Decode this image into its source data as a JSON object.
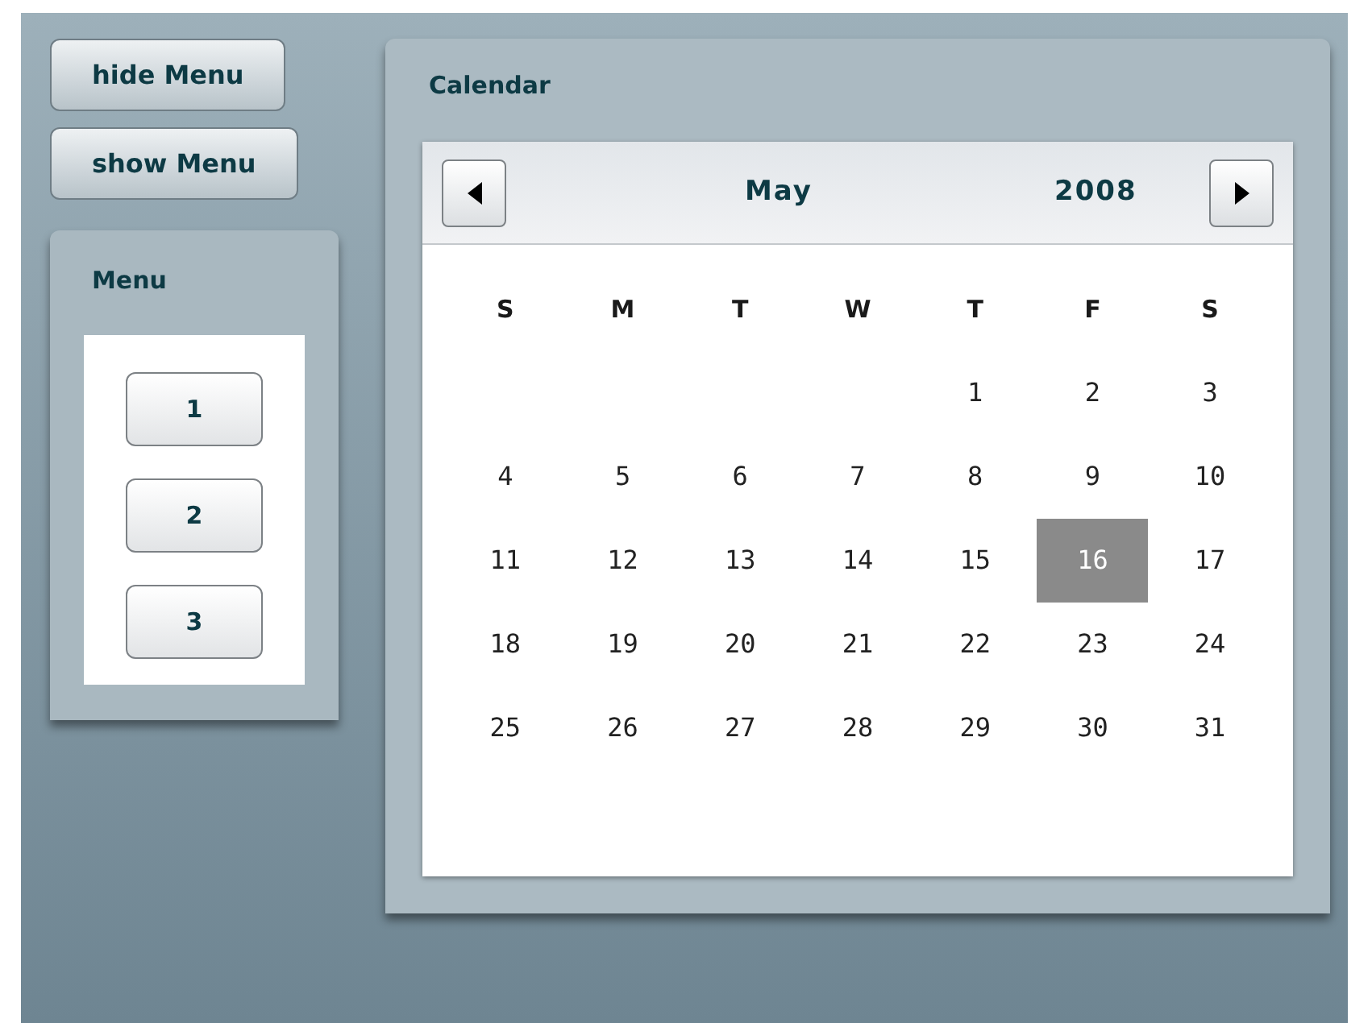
{
  "top_buttons": [
    "hide Menu",
    "show Menu"
  ],
  "menu_panel": {
    "title": "Menu",
    "buttons": [
      "1",
      "2",
      "3"
    ]
  },
  "calendar_panel": {
    "title": "Calendar",
    "month": "May",
    "year": "2008",
    "weekdays": [
      "S",
      "M",
      "T",
      "W",
      "T",
      "F",
      "S"
    ],
    "weeks": [
      {
        "kind": "partial",
        "days": [
          {
            "day": "1",
            "selected": false
          },
          {
            "day": "2",
            "selected": false
          },
          {
            "day": "3",
            "selected": false
          }
        ]
      },
      {
        "kind": "full",
        "days": [
          {
            "day": "4",
            "selected": false
          },
          {
            "day": "5",
            "selected": false
          },
          {
            "day": "6",
            "selected": false
          },
          {
            "day": "7",
            "selected": false
          },
          {
            "day": "8",
            "selected": false
          },
          {
            "day": "9",
            "selected": false
          },
          {
            "day": "10",
            "selected": false
          }
        ]
      },
      {
        "kind": "full",
        "days": [
          {
            "day": "11",
            "selected": false
          },
          {
            "day": "12",
            "selected": false
          },
          {
            "day": "13",
            "selected": false
          },
          {
            "day": "14",
            "selected": false
          },
          {
            "day": "15",
            "selected": false
          },
          {
            "day": "16",
            "selected": true
          },
          {
            "day": "17",
            "selected": false
          }
        ]
      },
      {
        "kind": "full",
        "days": [
          {
            "day": "18",
            "selected": false
          },
          {
            "day": "19",
            "selected": false
          },
          {
            "day": "20",
            "selected": false
          },
          {
            "day": "21",
            "selected": false
          },
          {
            "day": "22",
            "selected": false
          },
          {
            "day": "23",
            "selected": false
          },
          {
            "day": "24",
            "selected": false
          }
        ]
      },
      {
        "kind": "full",
        "days": [
          {
            "day": "25",
            "selected": false
          },
          {
            "day": "26",
            "selected": false
          },
          {
            "day": "27",
            "selected": false
          },
          {
            "day": "28",
            "selected": false
          },
          {
            "day": "29",
            "selected": false
          },
          {
            "day": "30",
            "selected": false
          },
          {
            "day": "31",
            "selected": false
          }
        ]
      }
    ]
  }
}
